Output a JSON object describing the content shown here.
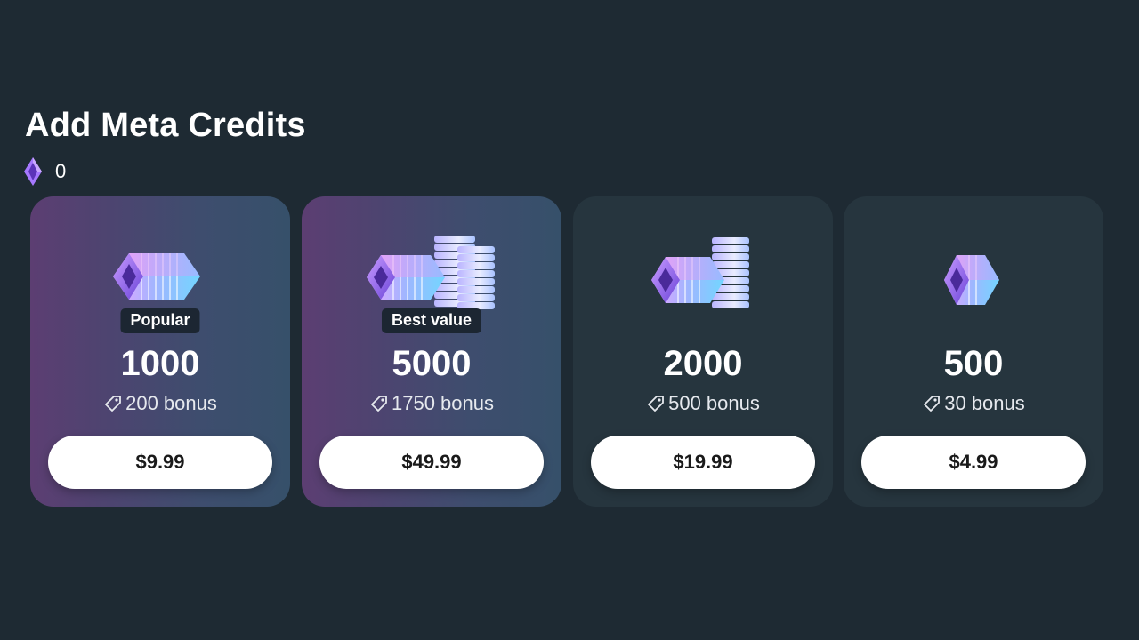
{
  "header": {
    "title": "Add Meta Credits",
    "balance_icon": "meta-credit-gem-icon",
    "balance": "0"
  },
  "colors": {
    "background": "#1e2a33",
    "featured_gradient_start": "#5c3e72",
    "featured_gradient_end": "#36506a",
    "plain_card": "#26353e",
    "button": "#ffffff",
    "badge": "#1c2632"
  },
  "packs": [
    {
      "badge": "Popular",
      "amount": "1000",
      "bonus": "200 bonus",
      "price": "$9.99",
      "image": "single-credit-stack"
    },
    {
      "badge": "Best value",
      "amount": "5000",
      "bonus": "1750 bonus",
      "price": "$49.99",
      "image": "credit-stack-with-tall-coins"
    },
    {
      "badge": "",
      "amount": "2000",
      "bonus": "500 bonus",
      "price": "$19.99",
      "image": "credit-stack-with-coins"
    },
    {
      "badge": "",
      "amount": "500",
      "bonus": "30 bonus",
      "price": "$4.99",
      "image": "small-credit-stack"
    }
  ]
}
